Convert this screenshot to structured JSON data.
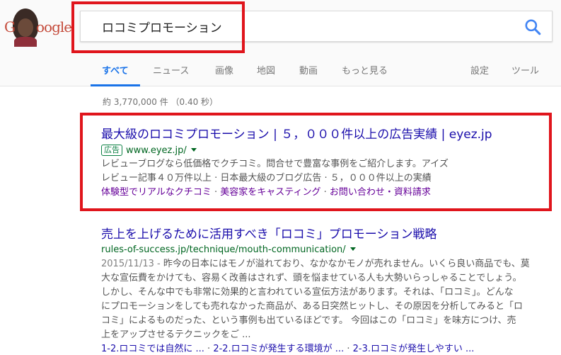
{
  "logo": {
    "alt": "G oogle",
    "letter": "G",
    "rest": "oogle"
  },
  "search": {
    "query": "ロコミプロモーション"
  },
  "tabs": [
    {
      "label": "すべて",
      "active": true
    },
    {
      "label": "ニュース"
    },
    {
      "label": "画像"
    },
    {
      "label": "地図"
    },
    {
      "label": "動画"
    },
    {
      "label": "もっと見る"
    },
    {
      "label": "設定"
    },
    {
      "label": "ツール"
    }
  ],
  "stats": "約 3,770,000 件 （0.40 秒）",
  "ad_result": {
    "title": "最大級のロコミプロモーション | ５，０００件以上の広告実績 | eyez.jp",
    "badge": "広告",
    "url": "www.eyez.jp/",
    "desc_1": "レビューブログなら低価格でクチコミ。問合せで豊富な事例をご紹介します。アイズ",
    "desc_2": "レビュー記事４０万件以上 · 日本最大級のブログ広告 · ５，０００件以上の実績",
    "sitelinks": [
      "体験型でリアルなクチコミ",
      "美容家をキャスティング",
      "お問い合わせ・資料請求"
    ]
  },
  "organic_result": {
    "title": "売上を上げるために活用すべき「ロコミ」プロモーション戦略",
    "url": "rules-of-success.jp/technique/mouth-communication/",
    "date": "2015/11/13 - ",
    "lines": [
      "昨今の日本にはモノが溢れており、なかなかモノが売れません。いくら良い商品でも、莫",
      "大な宣伝費をかけても、容易く改善はされず、頭を悩ませている人も大勢いらっしゃることでしょう。",
      "しかし、そんな中でも非常に効果的と言われている宣伝方法があります。それは、「ロコミ」。どんな",
      "にプロモーションをしても売れなかった商品が、ある日突然ヒットし、その原因を分析してみると「ロ",
      "コミ」によるものだった、という事例も出ているほどです。 今回はこの「ロコミ」を味方につけ、売",
      "上をアップさせるテクニックをご ..."
    ],
    "sub_links": [
      "1-2.ロコミでは自然に ...",
      "2-2.ロコミが発生する環境が ...",
      "2-3.ロコミが発生しやすい ..."
    ],
    "sub_sep": " · "
  },
  "separators": {
    "dot": " · "
  }
}
